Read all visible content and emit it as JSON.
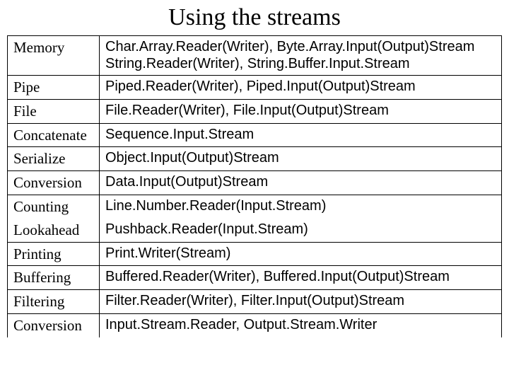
{
  "title": "Using the streams",
  "rows": [
    {
      "category": "Memory",
      "value": "Char.Array.Reader(Writer), Byte.Array.Input(Output)Stream String.Reader(Writer), String.Buffer.Input.Stream"
    },
    {
      "category": "Pipe",
      "value": "Piped.Reader(Writer), Piped.Input(Output)Stream"
    },
    {
      "category": "File",
      "value": "File.Reader(Writer), File.Input(Output)Stream"
    },
    {
      "category": "Concatenate",
      "value": "Sequence.Input.Stream"
    },
    {
      "category": "Serialize",
      "value": "Object.Input(Output)Stream"
    },
    {
      "category": "Conversion",
      "value": "Data.Input(Output)Stream"
    },
    {
      "category": "Counting",
      "value": "Line.Number.Reader(Input.Stream)"
    },
    {
      "category": "Lookahead",
      "value": "Pushback.Reader(Input.Stream)"
    },
    {
      "category": "Printing",
      "value": "Print.Writer(Stream)"
    },
    {
      "category": "Buffering",
      "value": "Buffered.Reader(Writer), Buffered.Input(Output)Stream"
    },
    {
      "category": "Filtering",
      "value": "Filter.Reader(Writer), Filter.Input(Output)Stream"
    },
    {
      "category": "Conversion",
      "value": "Input.Stream.Reader, Output.Stream.Writer"
    }
  ]
}
